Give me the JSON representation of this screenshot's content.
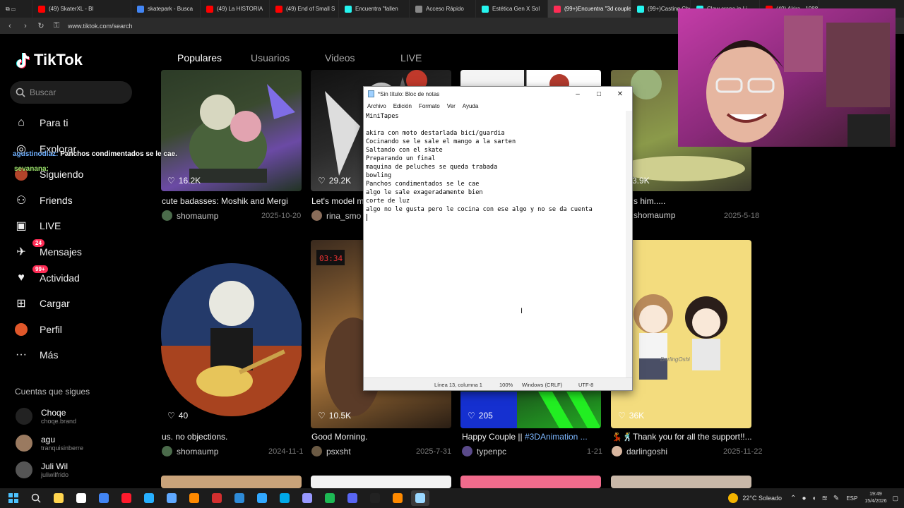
{
  "browser": {
    "tabs": [
      {
        "title": "(49) SkaterXL - Bl",
        "color": "#ff0000"
      },
      {
        "title": "skatepark - Busca",
        "color": "#4285f4"
      },
      {
        "title": "(49) La HISTORIA",
        "color": "#ff0000"
      },
      {
        "title": "(49) End of Small S",
        "color": "#ff0000"
      },
      {
        "title": "Encuentra \"fallen",
        "color": "#25f4ee"
      },
      {
        "title": "Acceso Rápido",
        "color": "#888888"
      },
      {
        "title": "Estética Gen X Sol",
        "color": "#25f4ee"
      },
      {
        "title": "(99+)Encuentra \"3d couple",
        "color": "#fe2c55"
      },
      {
        "title": "(99+)Casting Cho",
        "color": "#25f4ee"
      },
      {
        "title": "Claw crane in Li",
        "color": "#25f4ee"
      },
      {
        "title": "(49) Akira - 1988",
        "color": "#ff0000"
      }
    ],
    "active_tab": 7,
    "url": "www.tiktok.com/search"
  },
  "tiktok": {
    "brand": "TikTok",
    "search_placeholder": "Buscar",
    "nav": [
      {
        "label": "Para ti",
        "icon": "home-icon"
      },
      {
        "label": "Explorar",
        "icon": "compass-icon"
      },
      {
        "label": "Siguiendo",
        "icon": "following-icon"
      },
      {
        "label": "Friends",
        "icon": "friends-icon"
      },
      {
        "label": "LIVE",
        "icon": "live-icon"
      },
      {
        "label": "Mensajes",
        "icon": "messages-icon",
        "badge": "24"
      },
      {
        "label": "Actividad",
        "icon": "activity-icon",
        "badge": "99+"
      },
      {
        "label": "Cargar",
        "icon": "upload-icon"
      },
      {
        "label": "Perfil",
        "icon": "profile-icon"
      },
      {
        "label": "Más",
        "icon": "more-icon"
      }
    ],
    "following_header": "Cuentas que sigues",
    "following": [
      {
        "name": "Choqe",
        "handle": "choqe.brand"
      },
      {
        "name": "agu",
        "handle": "tranquisinberre"
      },
      {
        "name": "Juli Wil",
        "handle": "juliwilfrido"
      }
    ],
    "top_tabs": [
      "Populares",
      "Usuarios",
      "Videos",
      "LIVE"
    ],
    "row1": [
      {
        "likes": "16.2K",
        "title": "cute badasses: Moshik and Mergi",
        "user": "shomaump",
        "date": "2025-10-20"
      },
      {
        "likes": "29.2K",
        "title": "Let's model m",
        "user": "rina_smo",
        "date": ""
      },
      {
        "likes": "",
        "title": "",
        "user": "",
        "date": ""
      },
      {
        "likes": "3.9K",
        "title": "s him.....",
        "user": "shomaump",
        "date": "2025-5-18"
      }
    ],
    "row2": [
      {
        "likes": "40",
        "title": "us. no objections.",
        "user": "shomaump",
        "date": "2024-11-1"
      },
      {
        "likes": "10.5K",
        "title": "Good Morning.",
        "user": "psxsht",
        "date": "2025-7-31"
      },
      {
        "likes": "205",
        "title": "Happy Couple || ",
        "hashtag": "#3DAnimation ...",
        "user": "typenpc",
        "date": "1-21"
      },
      {
        "likes": "36K",
        "title": "💃🕺Thank you for all the support!!...",
        "user": "darlingoshi",
        "date": "2025-11-22"
      }
    ],
    "thumb_text": "DarlingOshi",
    "clock_display": "03:34"
  },
  "chat": [
    {
      "user": "agustinodiaz:",
      "message": "Panchos condimentados se le cae."
    },
    {
      "user": "sevanana:",
      "message": ""
    }
  ],
  "notepad": {
    "title": "*Sin título: Bloc de notas",
    "menu": [
      "Archivo",
      "Edición",
      "Formato",
      "Ver",
      "Ayuda"
    ],
    "lines": [
      "MiniTapes",
      "",
      "akira con moto destarlada bici/guardia",
      "Cocinando se le sale el mango a la sarten",
      "Saltando con el skate",
      "Preparando un final",
      "maquina de peluches se queda trabada",
      "bowling",
      "Panchos condimentados se le cae",
      "algo le sale exageradamente bien",
      "corte de luz",
      "algo no le gusta pero le cocina con ese algo y no se da cuenta",
      ""
    ],
    "status": {
      "position": "Línea 13, columna 1",
      "zoom": "100%",
      "eol": "Windows (CRLF)",
      "encoding": "UTF-8"
    }
  },
  "taskbar": {
    "apps": [
      "#ffd54f",
      "#ffffff",
      "#4285f4",
      "#ff1b2d",
      "#27b0ff",
      "#5fa8ff",
      "#ff8a00",
      "#d32f2f",
      "#2e8bd8",
      "#31a8ff",
      "#00a8e8",
      "#9999ff",
      "#1db954",
      "#5865f2",
      "#222222",
      "#ff8a00",
      "#9ad8ff"
    ],
    "weather": "22°C  Soleado",
    "lang": "ESP",
    "time": "19:49",
    "date": "15/4/2026"
  }
}
